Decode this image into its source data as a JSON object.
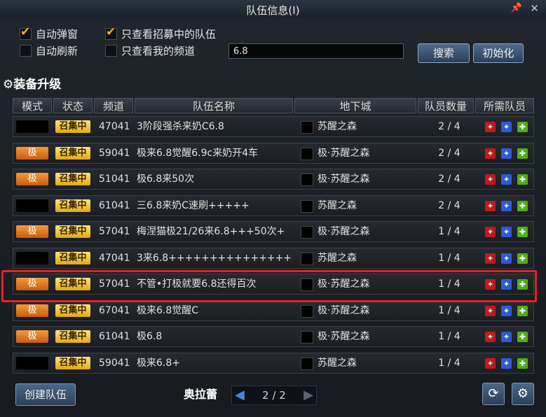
{
  "window": {
    "title": "队伍信息(I)"
  },
  "options": {
    "auto_popup": "自动弹窗",
    "recruiting_only": "只查看招募中的队伍",
    "auto_refresh": "自动刷新",
    "my_channel_only": "只查看我的频道"
  },
  "search": {
    "value": "6.8",
    "search_label": "搜索",
    "reset_label": "初始化"
  },
  "background": {
    "equip_upgrade": "装备升级",
    "town": "奥拉蕾"
  },
  "table": {
    "headers": [
      "模式",
      "状态",
      "频道",
      "队伍名称",
      "地下城",
      "队员数量",
      "所需队员"
    ],
    "rows": [
      {
        "mode": "",
        "status": "召集中",
        "channel": "47041",
        "name": "3阶段强杀来奶C6.8",
        "dungeon": "苏醒之森",
        "members": "2 / 4"
      },
      {
        "mode": "极",
        "status": "召集中",
        "channel": "59041",
        "name": "极来6.8觉醒6.9c来奶开4车",
        "dungeon": "极·苏醒之森",
        "members": "2 / 4"
      },
      {
        "mode": "极",
        "status": "召集中",
        "channel": "51041",
        "name": "极6.8来50次",
        "dungeon": "极·苏醒之森",
        "members": "2 / 4"
      },
      {
        "mode": "",
        "status": "召集中",
        "channel": "61041",
        "name": "三6.8来奶C速刷+++++",
        "dungeon": "苏醒之森",
        "members": "2 / 4"
      },
      {
        "mode": "极",
        "status": "召集中",
        "channel": "57041",
        "name": "梅涅猫极21/26来6.8+++50次+",
        "dungeon": "极·苏醒之森",
        "members": "1 / 4"
      },
      {
        "mode": "",
        "status": "召集中",
        "channel": "47041",
        "name": "3来6.8+++++++++++++++",
        "dungeon": "苏醒之森",
        "members": "1 / 4"
      },
      {
        "mode": "极",
        "status": "召集中",
        "channel": "57041",
        "name": "不管•打极就要6.8还得百次",
        "dungeon": "极·苏醒之森",
        "members": "1 / 4"
      },
      {
        "mode": "极",
        "status": "召集中",
        "channel": "67041",
        "name": "极来6.8觉醒C",
        "dungeon": "极·苏醒之森",
        "members": "1 / 4"
      },
      {
        "mode": "极",
        "status": "召集中",
        "channel": "61041",
        "name": "极6.8",
        "dungeon": "极·苏醒之森",
        "members": "1 / 4"
      },
      {
        "mode": "",
        "status": "召集中",
        "channel": "59041",
        "name": "极来6.8+",
        "dungeon": "苏醒之森",
        "members": "1 / 4"
      }
    ]
  },
  "footer": {
    "create_label": "创建队伍",
    "page": "2 / 2"
  }
}
